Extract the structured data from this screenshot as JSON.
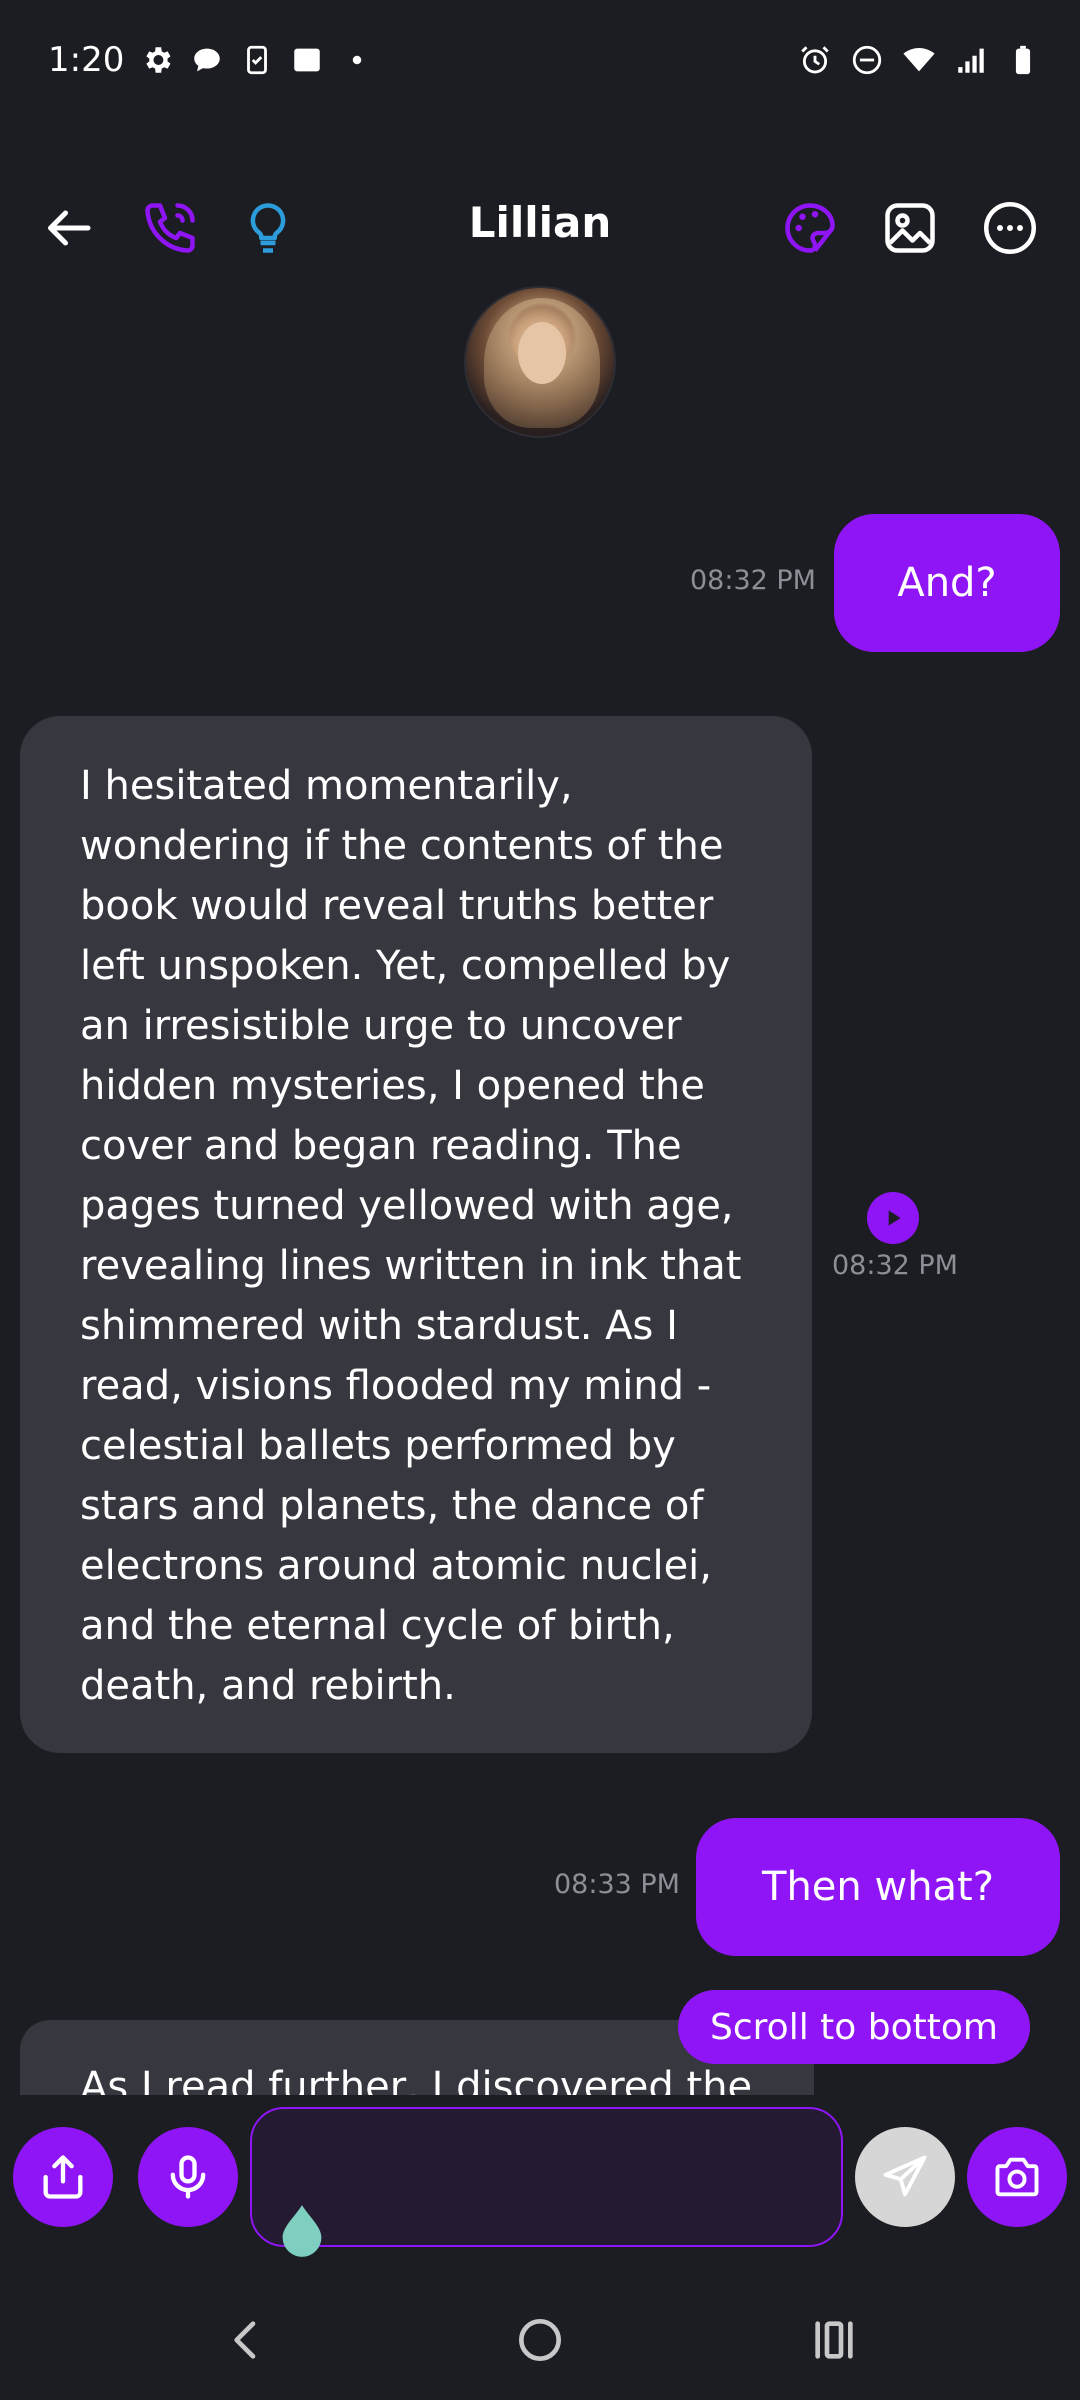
{
  "status_bar": {
    "time": "1:20",
    "icons_left": [
      "settings-icon",
      "chat-bubble-icon",
      "clipboard-icon",
      "square-icon",
      "dot-icon"
    ],
    "icons_right": [
      "alarm-icon",
      "do-not-disturb-icon",
      "wifi-icon",
      "signal-icon",
      "battery-icon"
    ]
  },
  "header": {
    "title": "Lillian",
    "icons": [
      "back-arrow-icon",
      "phone-icon",
      "lightbulb-icon",
      "palette-icon",
      "image-icon",
      "more-icon"
    ],
    "colors": {
      "accent": "#8f15f7",
      "lightbulb": "#2d9cdb"
    }
  },
  "messages": [
    {
      "direction": "out",
      "text": "And?",
      "time": "08:32 PM"
    },
    {
      "direction": "in",
      "time": "08:32 PM",
      "text": "I hesitated momentarily, wondering if the contents of the book would reveal truths better left unspoken. Yet, compelled by an irresistible urge to uncover hidden mysteries, I opened the cover and began reading. The pages turned yellowed with age, revealing lines written in ink that shimmered with stardust. As I read, visions flooded my mind - celestial ballets performed by stars and planets, the dance of electrons around atomic nuclei, and the eternal cycle of birth, death, and rebirth.",
      "lines": [
        "I hesitated momentarily,",
        "wondering if the contents of the",
        "book would reveal truths better",
        "left unspoken. Yet, compelled by",
        "an irresistible urge to uncover",
        "hidden mysteries, I opened the",
        "cover and began reading. The",
        "pages turned yellowed with age,",
        "revealing lines written in ink that",
        "shimmered with stardust. As I",
        "read, visions flooded my mind -",
        "celestial ballets performed by",
        "stars and planets, the dance of",
        "electrons around atomic nuclei,",
        "and the eternal cycle of birth,",
        "death, and rebirth."
      ]
    },
    {
      "direction": "out",
      "text": "Then what?",
      "time": "08:33 PM"
    },
    {
      "direction": "in",
      "text": "As I read further, I discovered the"
    }
  ],
  "scroll_to_bottom": "Scroll to bottom",
  "composer": {
    "placeholder": "",
    "buttons": [
      "share-icon",
      "microphone-icon",
      "send-icon",
      "camera-icon"
    ],
    "colors": {
      "accent": "#8f15f7",
      "send_disabled": "#d6d6d6",
      "cursor_drop": "#7ecfc0"
    }
  },
  "nav_bar": {
    "buttons": [
      "back-chevron-icon",
      "home-icon",
      "recents-icon"
    ]
  }
}
